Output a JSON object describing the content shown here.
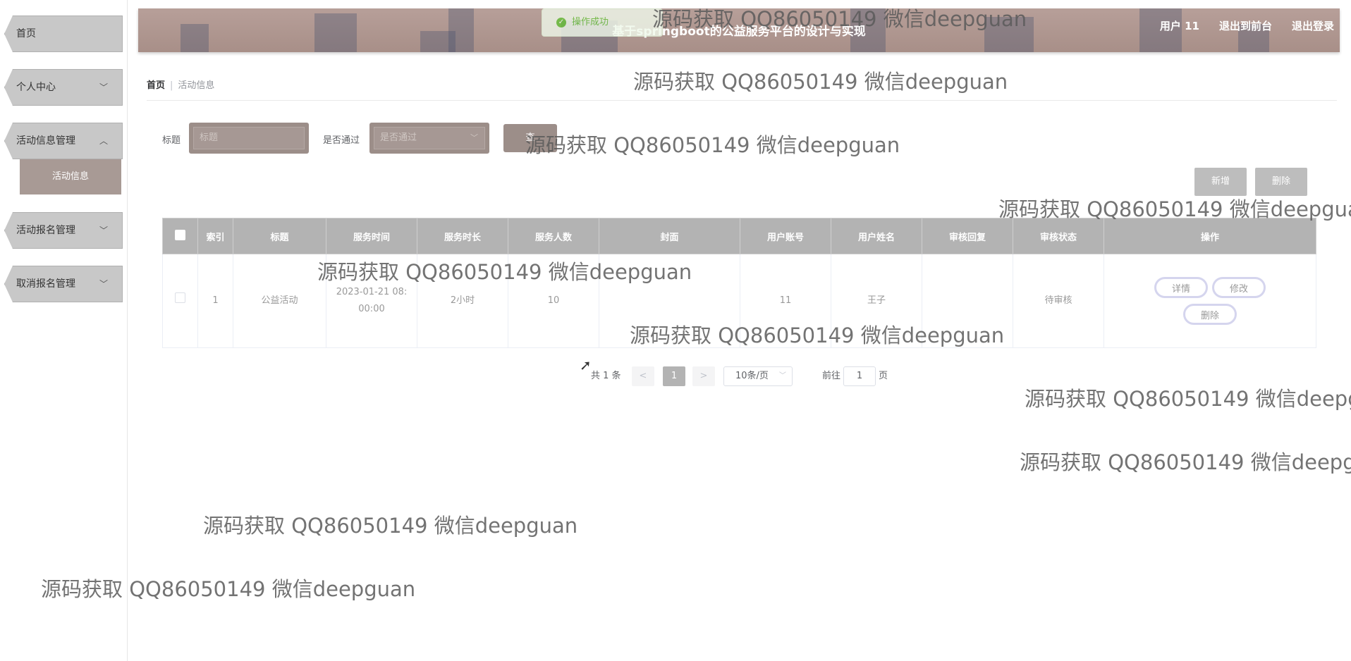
{
  "sidebar": {
    "items": [
      {
        "label": "首页"
      },
      {
        "label": "个人中心"
      },
      {
        "label": "活动信息管理"
      },
      {
        "label": "活动报名管理"
      },
      {
        "label": "取消报名管理"
      }
    ],
    "active_sub": "活动信息"
  },
  "header": {
    "title": "基于springboot的公益服务平台的设计与实现",
    "links": [
      "用户 11",
      "退出到前台",
      "退出登录"
    ],
    "toast": "操作成功"
  },
  "breadcrumb": {
    "home": "首页",
    "separator": "|",
    "current": "活动信息"
  },
  "search": {
    "title_label": "标题",
    "title_placeholder": "标题",
    "pass_label": "是否通过",
    "pass_placeholder": "是否通过",
    "query_button": "查"
  },
  "actions": {
    "add": "新增",
    "delete": "删除"
  },
  "table": {
    "headers": [
      "索引",
      "标题",
      "服务时间",
      "服务时长",
      "服务人数",
      "封面",
      "用户账号",
      "用户姓名",
      "审核回复",
      "审核状态",
      "操作"
    ],
    "rows": [
      {
        "index": "1",
        "title": "公益活动",
        "time_line1": "2023-01-21 08:",
        "time_line2": "00:00",
        "duration": "2小时",
        "people": "10",
        "cover": "",
        "account": "11",
        "name": "王子",
        "reply": "",
        "status": "待审核",
        "ops": [
          "详情",
          "修改",
          "删除"
        ]
      }
    ]
  },
  "pagination": {
    "total": "共 1 条",
    "prev": "<",
    "page": "1",
    "next": ">",
    "page_size": "10条/页",
    "goto_prefix": "前往",
    "goto_value": "1",
    "goto_suffix": "页"
  },
  "watermark": "源码获取 QQ86050149 微信deepguan"
}
